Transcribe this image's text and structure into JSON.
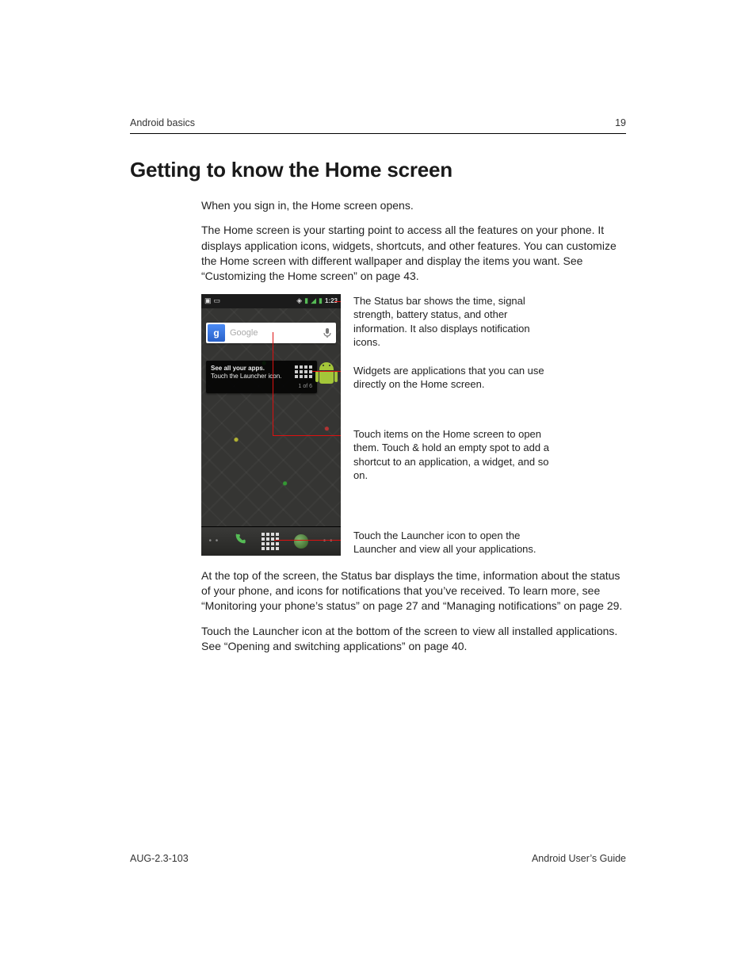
{
  "header": {
    "section": "Android basics",
    "page_number": "19"
  },
  "title": "Getting to know the Home screen",
  "intro": {
    "p1": "When you sign in, the Home screen opens.",
    "p2": "The Home screen is your starting point to access all the features on your phone. It displays application icons, widgets, shortcuts, and other features. You can customize the Home screen with different wallpaper and display the items you want. See “Customizing the Home screen” on page 43."
  },
  "phone": {
    "status_time": "1:23",
    "search_placeholder": "Google",
    "g_label": "g",
    "tip_line1": "See all your apps.",
    "tip_line2": "Touch the Launcher icon.",
    "tip_count": "1 of 6",
    "dock_dots": "• •"
  },
  "callouts": {
    "status": "The Status bar shows the time, signal strength, battery status, and other information. It also displays notification icons.",
    "widgets": "Widgets are applications that you can use directly on the Home screen.",
    "touch": "Touch items on the Home screen to open them. Touch & hold an empty spot to add a shortcut to an application, a widget, and so on.",
    "launcher": "Touch the Launcher icon to open the Launcher and view all your applications."
  },
  "after": {
    "p1": "At the top of the screen, the Status bar displays the time, information about the status of your phone, and icons for notifications that you’ve received. To learn more, see “Monitoring your phone’s status” on page 27 and “Managing notifications” on page 29.",
    "p2": "Touch the Launcher icon at the bottom of the screen to view all installed applications. See “Opening and switching applications” on page 40."
  },
  "footer": {
    "left": "AUG-2.3-103",
    "right": "Android User’s Guide"
  }
}
